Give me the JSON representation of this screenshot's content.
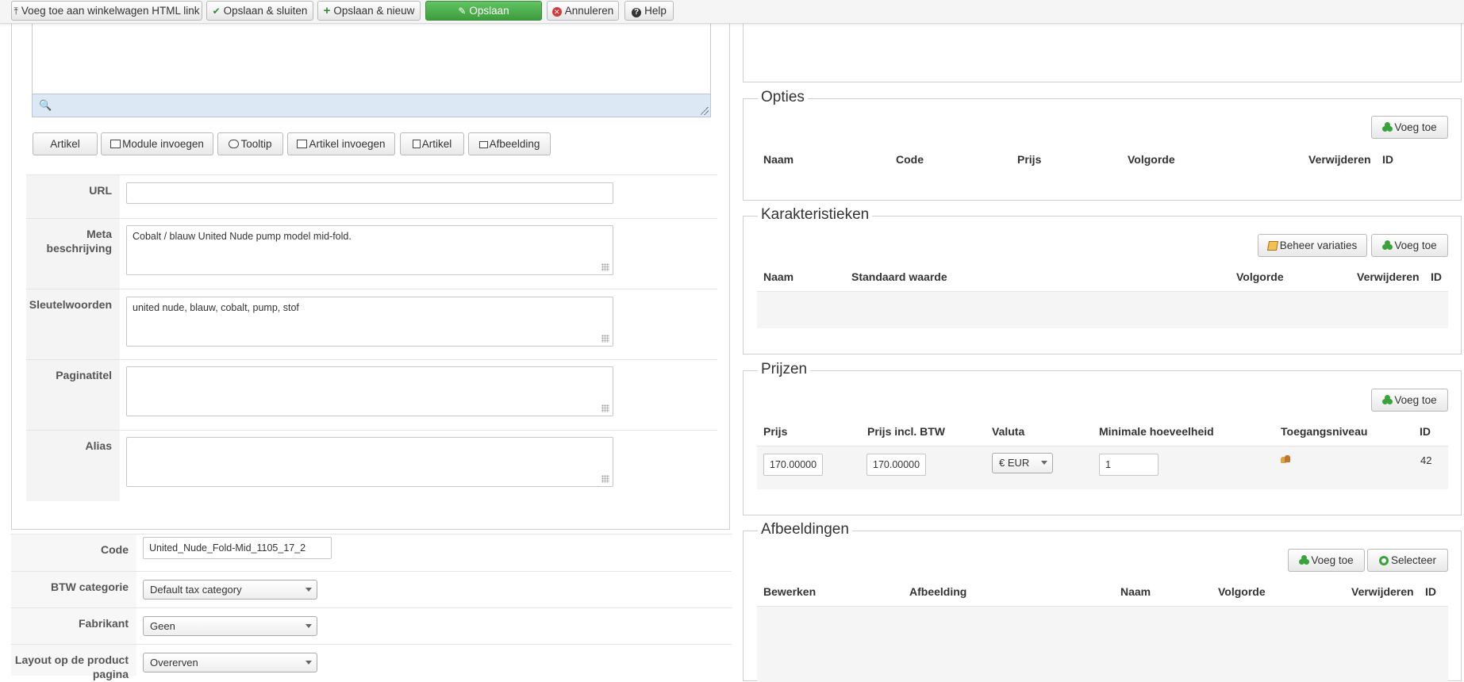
{
  "toolbar": {
    "add_cart_link": "Voeg toe aan winkelwagen HTML link",
    "save_close": "Opslaan & sluiten",
    "save_new": "Opslaan & nieuw",
    "save": "Opslaan",
    "cancel": "Annuleren",
    "help": "Help"
  },
  "editor": {
    "buttons": [
      "Artikel",
      "Module invoegen",
      "Tooltip",
      "Artikel invoegen",
      "Artikel",
      "Afbeelding"
    ]
  },
  "meta_fields": {
    "url": {
      "label": "URL",
      "value": ""
    },
    "meta_description": {
      "label": "Meta beschrijving",
      "value": "Cobalt / blauw United Nude pump model mid-fold."
    },
    "keywords": {
      "label": "Sleutelwoorden",
      "value": "united nude, blauw, cobalt, pump, stof"
    },
    "page_title": {
      "label": "Paginatitel",
      "value": ""
    },
    "alias": {
      "label": "Alias",
      "value": ""
    }
  },
  "product_fields": {
    "code": {
      "label": "Code",
      "value": "United_Nude_Fold-Mid_1105_17_2"
    },
    "tax": {
      "label": "BTW categorie",
      "value": "Default tax category"
    },
    "manufacturer": {
      "label": "Fabrikant",
      "value": "Geen"
    },
    "layout": {
      "label": "Layout op de product pagina",
      "value": "Overerven"
    }
  },
  "options": {
    "legend": "Opties",
    "add": "Voeg toe",
    "headers": [
      "Naam",
      "Code",
      "Prijs",
      "Volgorde",
      "Verwijderen",
      "ID"
    ]
  },
  "characteristics": {
    "legend": "Karakteristieken",
    "manage_variations": "Beheer variaties",
    "add": "Voeg toe",
    "headers": [
      "Naam",
      "Standaard waarde",
      "Volgorde",
      "Verwijderen",
      "ID"
    ]
  },
  "prices": {
    "legend": "Prijzen",
    "add": "Voeg toe",
    "headers": [
      "Prijs",
      "Prijs incl. BTW",
      "Valuta",
      "Minimale hoeveelheid",
      "Toegangsniveau",
      "ID"
    ],
    "row": {
      "price": "170.00000",
      "price_incl": "170.00000",
      "currency": "€ EUR",
      "min_qty": "1",
      "id": "42"
    }
  },
  "images": {
    "legend": "Afbeeldingen",
    "add": "Voeg toe",
    "select": "Selecteer",
    "headers": [
      "Bewerken",
      "Afbeelding",
      "Naam",
      "Volgorde",
      "Verwijderen",
      "ID"
    ]
  }
}
